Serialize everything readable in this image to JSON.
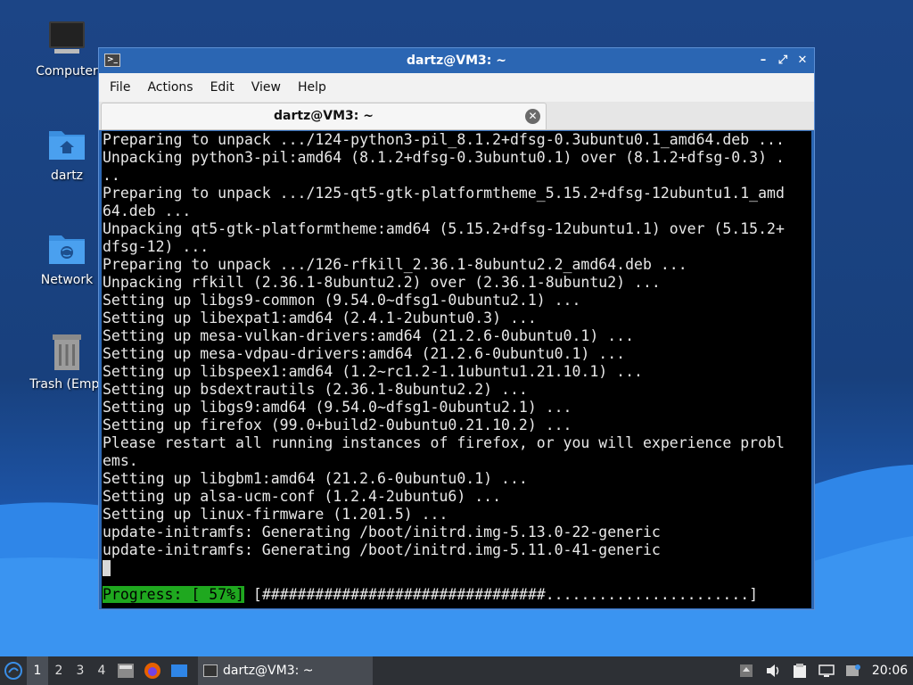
{
  "desktop": {
    "icons": [
      {
        "label": "Computer"
      },
      {
        "label": "dartz"
      },
      {
        "label": "Network"
      },
      {
        "label": "Trash (Empt"
      }
    ]
  },
  "window": {
    "title": "dartz@VM3: ~",
    "controls": {
      "minimize": "–",
      "maximize": "⤢",
      "close": "✕"
    },
    "menu": [
      "File",
      "Actions",
      "Edit",
      "View",
      "Help"
    ],
    "tab": {
      "label": "dartz@VM3: ~",
      "close": "✕"
    }
  },
  "terminal": {
    "lines": [
      "Preparing to unpack .../124-python3-pil_8.1.2+dfsg-0.3ubuntu0.1_amd64.deb ...",
      "Unpacking python3-pil:amd64 (8.1.2+dfsg-0.3ubuntu0.1) over (8.1.2+dfsg-0.3) .",
      "..",
      "Preparing to unpack .../125-qt5-gtk-platformtheme_5.15.2+dfsg-12ubuntu1.1_amd",
      "64.deb ...",
      "Unpacking qt5-gtk-platformtheme:amd64 (5.15.2+dfsg-12ubuntu1.1) over (5.15.2+",
      "dfsg-12) ...",
      "Preparing to unpack .../126-rfkill_2.36.1-8ubuntu2.2_amd64.deb ...",
      "Unpacking rfkill (2.36.1-8ubuntu2.2) over (2.36.1-8ubuntu2) ...",
      "Setting up libgs9-common (9.54.0~dfsg1-0ubuntu2.1) ...",
      "Setting up libexpat1:amd64 (2.4.1-2ubuntu0.3) ...",
      "Setting up mesa-vulkan-drivers:amd64 (21.2.6-0ubuntu0.1) ...",
      "Setting up mesa-vdpau-drivers:amd64 (21.2.6-0ubuntu0.1) ...",
      "Setting up libspeex1:amd64 (1.2~rc1.2-1.1ubuntu1.21.10.1) ...",
      "Setting up bsdextrautils (2.36.1-8ubuntu2.2) ...",
      "Setting up libgs9:amd64 (9.54.0~dfsg1-0ubuntu2.1) ...",
      "Setting up firefox (99.0+build2-0ubuntu0.21.10.2) ...",
      "Please restart all running instances of firefox, or you will experience probl",
      "ems.",
      "Setting up libgbm1:amd64 (21.2.6-0ubuntu0.1) ...",
      "Setting up alsa-ucm-conf (1.2.4-2ubuntu6) ...",
      "Setting up linux-firmware (1.201.5) ...",
      "update-initramfs: Generating /boot/initrd.img-5.13.0-22-generic",
      "update-initramfs: Generating /boot/initrd.img-5.11.0-41-generic"
    ],
    "progress_label": "Progress: [ 57%]",
    "progress_bar": " [################################.......................]",
    "progress_percent": 57
  },
  "taskbar": {
    "workspaces": [
      "1",
      "2",
      "3",
      "4"
    ],
    "active_workspace": "1",
    "task_label": "dartz@VM3: ~",
    "clock": "20:06"
  },
  "colors": {
    "progress_green": "#1fa81f",
    "titlebar_blue": "#2b66b3",
    "taskbar": "#2d3035"
  }
}
